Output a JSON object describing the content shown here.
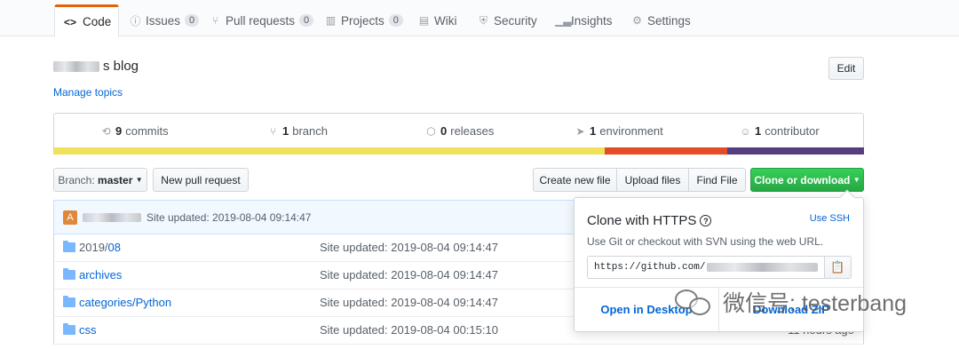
{
  "tabs": [
    {
      "icon": "code-icon",
      "glyph": "<>",
      "label": "Code",
      "count": null
    },
    {
      "icon": "issue-icon",
      "glyph": "ⓘ",
      "label": "Issues",
      "count": "0"
    },
    {
      "icon": "pull-request-icon",
      "glyph": "⑂",
      "label": "Pull requests",
      "count": "0"
    },
    {
      "icon": "project-icon",
      "glyph": "▥",
      "label": "Projects",
      "count": "0"
    },
    {
      "icon": "wiki-icon",
      "glyph": "▤",
      "label": "Wiki",
      "count": null
    },
    {
      "icon": "shield-icon",
      "glyph": "⛨",
      "label": "Security",
      "count": null
    },
    {
      "icon": "graph-icon",
      "glyph": "▁▃",
      "label": "Insights",
      "count": null
    },
    {
      "icon": "gear-icon",
      "glyph": "⚙",
      "label": "Settings",
      "count": null
    }
  ],
  "repo": {
    "description_suffix": "s blog",
    "manage_topics": "Manage topics",
    "edit_label": "Edit"
  },
  "summary": {
    "commits": {
      "num": "9",
      "label": "commits"
    },
    "branch": {
      "num": "1",
      "label": "branch"
    },
    "releases": {
      "num": "0",
      "label": "releases"
    },
    "environment": {
      "num": "1",
      "label": "environment"
    },
    "contributor": {
      "num": "1",
      "label": "contributor"
    }
  },
  "language_colors": [
    "#f1e05a",
    "#e34c26",
    "#563d7c"
  ],
  "language_fractions": [
    0.68,
    0.151,
    0.169
  ],
  "toolbar": {
    "branch_prefix": "Branch:",
    "branch_name": "master",
    "new_pull_request": "New pull request",
    "create_new_file": "Create new file",
    "upload_files": "Upload files",
    "find_file": "Find File",
    "clone_download": "Clone or download"
  },
  "latest_commit": {
    "message": "Site updated: 2019-08-04 09:14:47"
  },
  "files": [
    {
      "name": "2019/",
      "name_dim": "08",
      "message": "Site updated: 2019-08-04 09:14:47",
      "age": ""
    },
    {
      "name": "archives",
      "name_dim": "",
      "message": "Site updated: 2019-08-04 09:14:47",
      "age": ""
    },
    {
      "name": "categories/",
      "name_dim": "Python",
      "message": "Site updated: 2019-08-04 09:14:47",
      "age": ""
    },
    {
      "name": "css",
      "name_dim": "",
      "message": "Site updated: 2019-08-04 00:15:10",
      "age": "11 hours ago"
    }
  ],
  "clone_popover": {
    "title": "Clone with HTTPS",
    "use_ssh": "Use SSH",
    "description": "Use Git or checkout with SVN using the web URL.",
    "url_prefix": "https://github.com/",
    "open_desktop": "Open in Desktop",
    "download_zip": "Download ZIP"
  },
  "watermark": {
    "text": "微信号: testerbang"
  }
}
